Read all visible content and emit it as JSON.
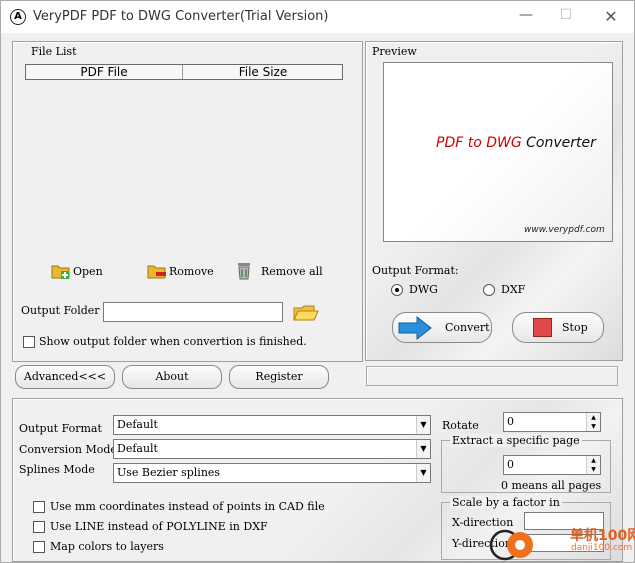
{
  "window": {
    "title": "VeryPDF PDF to DWG Converter(Trial Version)"
  },
  "file_list": {
    "label": "File List",
    "columns": [
      "PDF File",
      "File Size"
    ],
    "open_label": "Open",
    "remove_label": "Romove",
    "remove_all_label": "Remove all",
    "output_folder_label": "Output Folder",
    "output_folder_value": "",
    "show_folder_label": "Show output folder when convertion is finished."
  },
  "preview": {
    "label": "Preview",
    "brand_pdf": "PDF to DWG",
    "brand_rest": " Converter",
    "url": "www.verypdf.com",
    "output_format_label": "Output Format:",
    "formats": [
      "DWG",
      "DXF"
    ],
    "selected_format": "DWG",
    "convert_label": "Convert",
    "stop_label": "Stop"
  },
  "actions": {
    "advanced_label": "Advanced<<<",
    "about_label": "About",
    "register_label": "Register"
  },
  "advanced": {
    "output_format_label": "Output Format",
    "output_format_value": "Default",
    "conversion_mode_label": "Conversion Mode",
    "conversion_mode_value": "Default",
    "splines_mode_label": "Splines Mode",
    "splines_mode_value": "Use Bezier splines",
    "opt_mm": "Use mm coordinates instead of points in CAD file",
    "opt_line": "Use LINE instead of POLYLINE in DXF",
    "opt_map": "Map colors to layers",
    "rotate_label": "Rotate",
    "rotate_value": "0",
    "extract_label": "Extract a specific page",
    "extract_value": "0",
    "extract_note": "0 means all pages",
    "scale_label": "Scale by a factor in",
    "x_label": "X-direction",
    "y_label": "Y-direction",
    "x_value": "",
    "y_value": ""
  },
  "watermark": {
    "text1": "单机100网",
    "text2": "danji100.com"
  },
  "colors": {
    "accent_red": "#cc0000",
    "convert_arrow": "#2a8fd8",
    "stop_red": "#e04a4a"
  }
}
